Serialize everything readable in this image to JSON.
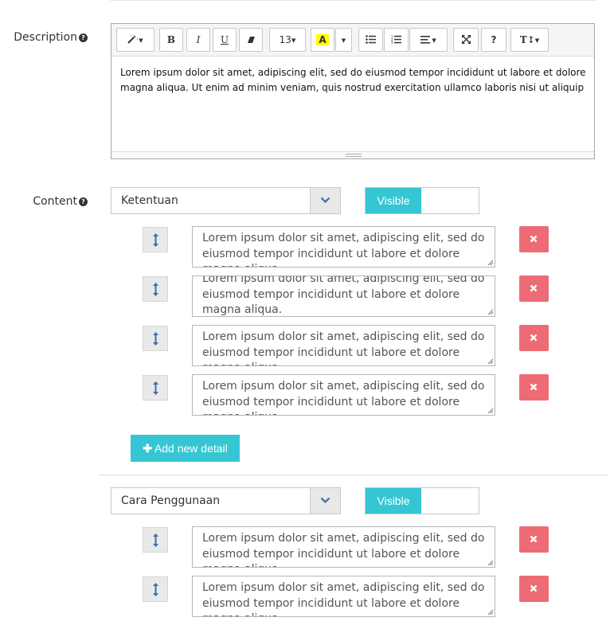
{
  "description": {
    "label": "Description",
    "help_icon": "question-circle-icon",
    "toolbar": {
      "magic_icon": "magic-wand-icon",
      "bold": "B",
      "italic": "I",
      "underline": "U",
      "eraser_icon": "eraser-icon",
      "font_size": "13",
      "color_letter": "A",
      "color_highlight": "#ffff00",
      "unordered_list_icon": "unordered-list-icon",
      "ordered_list_icon": "ordered-list-icon",
      "align_icon": "align-icon",
      "fullscreen_icon": "fullscreen-icon",
      "help": "?",
      "text_height": "T↕"
    },
    "text": "Lorem ipsum dolor sit amet, adipiscing elit, sed do eiusmod tempor incididunt ut labore et dolore magna aliqua. Ut enim ad minim veniam, quis nostrud exercitation ullamco laboris nisi ut aliquip"
  },
  "content": {
    "label": "Content",
    "help_icon": "question-circle-icon",
    "accent_color": "#36c6d3",
    "delete_color": "#ed6b75",
    "sections": [
      {
        "type_selected": "Ketentuan",
        "visibility": "Visible",
        "details": [
          {
            "text": "Lorem ipsum dolor sit amet, adipiscing elit, sed do eiusmod tempor incididunt ut labore et dolore magna aliqua."
          },
          {
            "text": "Lorem ipsum dolor sit amet, adipiscing elit, sed do eiusmod tempor incididunt ut labore et dolore magna aliqua."
          },
          {
            "text": "Lorem ipsum dolor sit amet, adipiscing elit, sed do eiusmod tempor incididunt ut labore et dolore magna aliqua."
          },
          {
            "text": "Lorem ipsum dolor sit amet, adipiscing elit, sed do eiusmod tempor incididunt ut labore et dolore magna aliqua."
          }
        ],
        "add_label": "Add new detail"
      },
      {
        "type_selected": "Cara Penggunaan",
        "visibility": "Visible",
        "details": [
          {
            "text": "Lorem ipsum dolor sit amet, adipiscing elit, sed do eiusmod tempor incididunt ut labore et dolore magna aliqua."
          },
          {
            "text": "Lorem ipsum dolor sit amet, adipiscing elit, sed do eiusmod tempor incididunt ut labore et dolore magna aliqua."
          }
        ]
      }
    ]
  }
}
